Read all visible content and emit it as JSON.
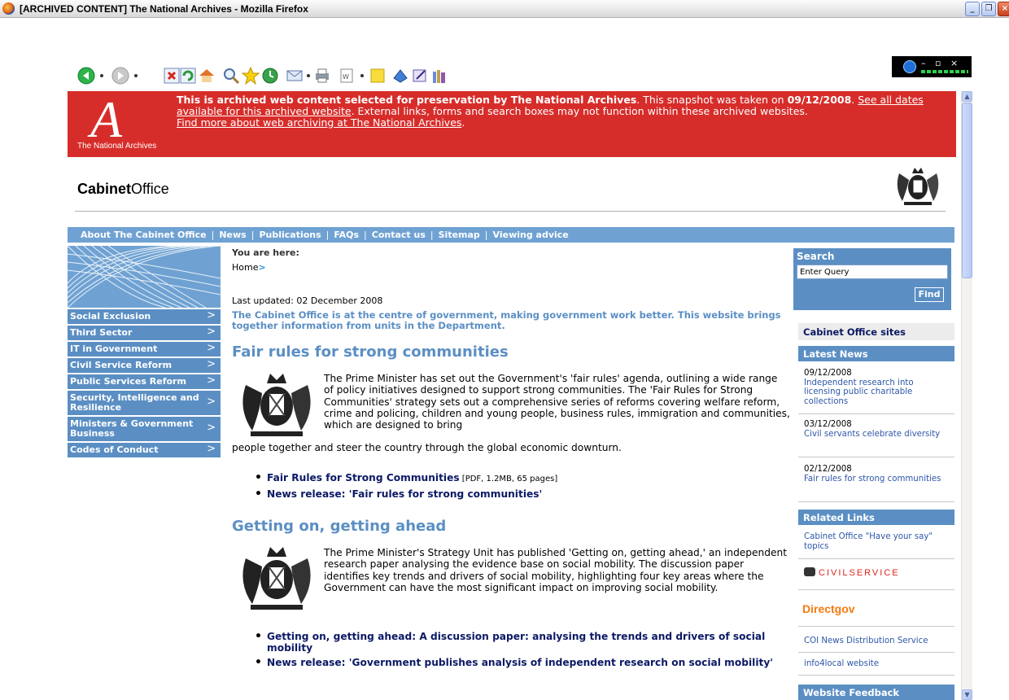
{
  "window": {
    "title": "[ARCHIVED CONTENT] The National Archives - Mozilla Firefox"
  },
  "banner": {
    "logo_text": "The National Archives",
    "logo_letter": "A",
    "msg_bold": "This is archived web content selected for preservation by The National Archives",
    "msg_1": ". This snapshot was taken on ",
    "snapshot_date": "09/12/2008",
    "msg_2": ". ",
    "link_see_all": "See all dates available for this archived website",
    "msg_3": ". External links, forms and search boxes may not function within these archived websites.",
    "link_find_more": "Find more about web archiving at The National Archives",
    "msg_4": "."
  },
  "header": {
    "logo_bold": "Cabinet",
    "logo_rest": "Office"
  },
  "nav": {
    "items": [
      "About The Cabinet Office",
      "News",
      "Publications",
      "FAQs",
      "Contact us",
      "Sitemap",
      "Viewing advice"
    ],
    "separator": "|"
  },
  "sidebar": {
    "items": [
      {
        "label": "Social Exclusion"
      },
      {
        "label": "Third Sector"
      },
      {
        "label": "IT in Government"
      },
      {
        "label": "Civil Service Reform"
      },
      {
        "label": "Public Services Reform"
      },
      {
        "label": "Security, Intelligence and Resilience"
      },
      {
        "label": "Ministers & Government Business"
      },
      {
        "label": "Codes of Conduct"
      }
    ],
    "chevron": ">"
  },
  "breadcrumb": {
    "label": "You are here:",
    "home": "Home",
    "arrow": ">"
  },
  "main": {
    "updated": "Last updated: 02 December 2008",
    "intro": "The Cabinet Office is at the centre of government, making government work better. This website brings together information from units in the Department.",
    "sections": [
      {
        "title": "Fair rules for strong communities",
        "para_a": "The Prime Minister has set out the Government's 'fair rules' agenda, outlining a wide range of policy initiatives designed to support strong communities. The 'Fair Rules for Strong Communities' strategy sets out a comprehensive series of reforms covering welfare reform, crime and policing, children and young people, business rules, immigration and communities, which are designed to bring",
        "para_b": "people together and steer the country through the global economic downturn.",
        "links": [
          {
            "label": "Fair Rules for Strong Communities",
            "meta": " [PDF, 1.2MB, 65 pages]"
          },
          {
            "label": "News release: 'Fair rules for strong communities'",
            "meta": ""
          }
        ]
      },
      {
        "title": "Getting on, getting ahead",
        "para_a": "The Prime Minister's Strategy Unit has published 'Getting on, getting ahead,' an independent research paper analysing the evidence base on social mobility. The discussion paper identifies key trends and drivers of social mobility, highlighting four key areas where the Government can have the most significant impact on improving social mobility.",
        "links": [
          {
            "label": "Getting on, getting ahead: A discussion paper: analysing the trends and drivers of social mobility",
            "meta": ""
          },
          {
            "label": "News release: 'Government publishes analysis of independent research on social mobility'",
            "meta": ""
          }
        ]
      }
    ]
  },
  "search": {
    "label": "Search",
    "placeholder": "Enter Query",
    "button": "Find"
  },
  "rhs": {
    "sites_heading": "Cabinet Office sites",
    "news_heading": "Latest News",
    "news": [
      {
        "date": "09/12/2008",
        "text": "Independent research into licensing public charitable collections"
      },
      {
        "date": "03/12/2008",
        "text": "Civil servants celebrate diversity"
      },
      {
        "date": "02/12/2008",
        "text": "Fair rules for strong communities"
      }
    ],
    "related_heading": "Related Links",
    "related_1": "Cabinet Office \"Have your say\" topics",
    "civil_service": "CIVILSERVICE",
    "directgov": "Directgov",
    "coi": "COI News Distribution Service",
    "info4local": "info4local website",
    "feedback_heading": "Website Feedback"
  },
  "icons": [
    "firefox-icon",
    "back-icon",
    "forward-icon",
    "stop-icon",
    "reload-icon",
    "home-icon",
    "search-icon",
    "bookmark-star-icon",
    "history-icon",
    "mail-icon",
    "print-icon",
    "page-icon",
    "note-icon",
    "tools-icon",
    "edit-icon",
    "library-icon"
  ],
  "colors": {
    "banner_red": "#d72d2a",
    "nav_blue": "#6fa2d3",
    "link_navy": "#0b1965",
    "heading_blue": "#5b8fc4"
  }
}
